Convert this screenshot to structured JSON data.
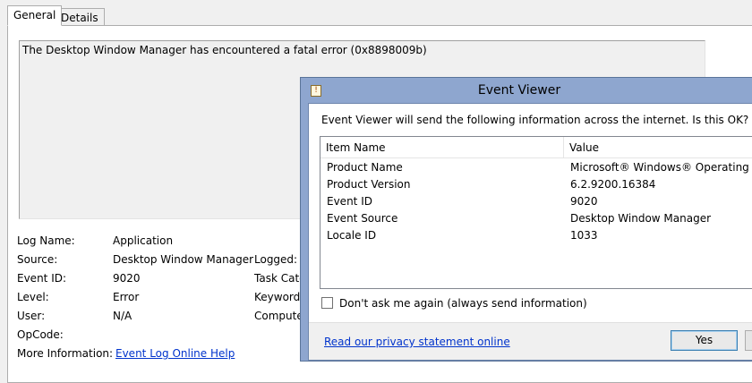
{
  "tabs": [
    {
      "label": "General"
    },
    {
      "label": "Details"
    }
  ],
  "message": "The Desktop Window Manager has encountered a fatal error (0x8898009b)",
  "details": {
    "log_name_label": "Log Name:",
    "log_name_value": "Application",
    "source_label": "Source:",
    "source_value": "Desktop Window Manager",
    "event_id_label": "Event ID:",
    "event_id_value": "9020",
    "level_label": "Level:",
    "level_value": "Error",
    "user_label": "User:",
    "user_value": "N/A",
    "opcode_label": "OpCode:",
    "opcode_value": "",
    "more_info_label": "More Information:",
    "more_info_link": "Event Log Online Help",
    "logged_label": "Logged:",
    "task_category_label": "Task Cate",
    "keywords_label": "Keywords",
    "computer_label": "Compute"
  },
  "dialog": {
    "title": "Event Viewer",
    "question": "Event Viewer will send the following information across the internet. Is this OK?",
    "columns": {
      "name": "Item Name",
      "value": "Value"
    },
    "rows": [
      {
        "name": "Product Name",
        "value": "Microsoft® Windows® Operating Syst"
      },
      {
        "name": "Product Version",
        "value": "6.2.9200.16384"
      },
      {
        "name": "Event ID",
        "value": "9020"
      },
      {
        "name": "Event Source",
        "value": "Desktop Window Manager"
      },
      {
        "name": "Locale ID",
        "value": "1033"
      }
    ],
    "checkbox_label": "Don't ask me again (always send information)",
    "checkbox_checked": false,
    "privacy_link": "Read our privacy statement online",
    "yes_button": "Yes"
  },
  "colors": {
    "titlebar": "#8ea6cf",
    "link": "#0033cc",
    "default_button_border": "#3c7fb1"
  }
}
